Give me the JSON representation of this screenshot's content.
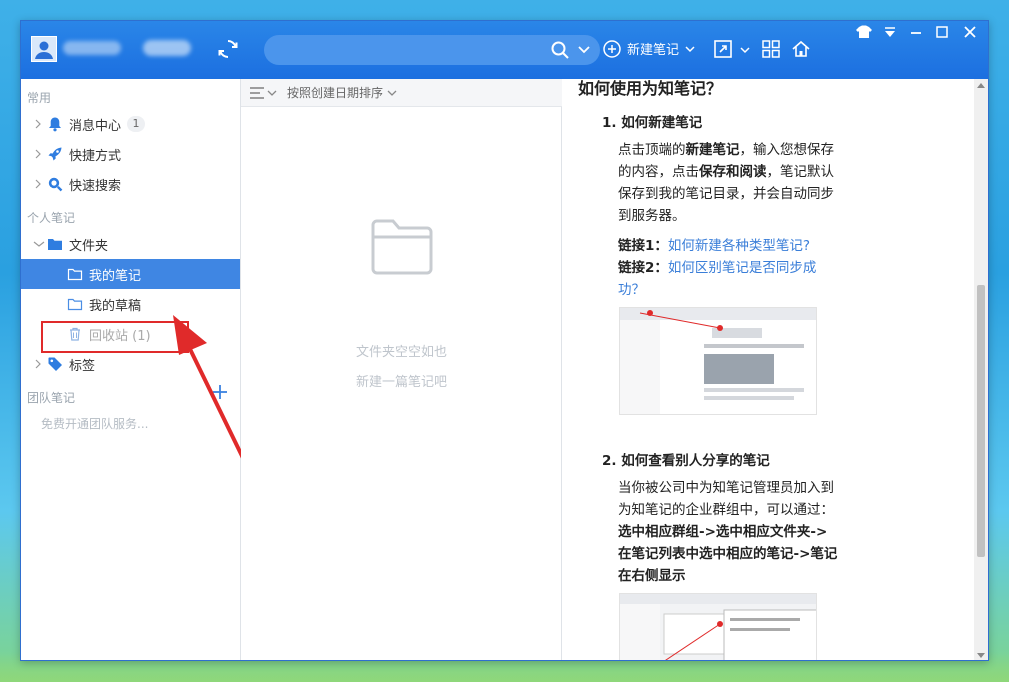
{
  "window": {
    "user_name": "",
    "search": {
      "placeholder": ""
    },
    "toolbar": {
      "new_note_label": "新建笔记"
    }
  },
  "sidebar": {
    "common_title": "常用",
    "common_items": [
      {
        "label": "消息中心",
        "badge": "1"
      },
      {
        "label": "快捷方式"
      },
      {
        "label": "快速搜索"
      }
    ],
    "personal_title": "个人笔记",
    "folder_label": "文件夹",
    "folder_children": [
      {
        "label": "我的笔记"
      },
      {
        "label": "我的草稿"
      },
      {
        "label": "回收站 (1)"
      }
    ],
    "tags_label": "标签",
    "team_title": "团队笔记",
    "team_tip": "免费开通团队服务..."
  },
  "list": {
    "sort_label": "按照创建日期排序",
    "empty_line1": "文件夹空空如也",
    "empty_line2": "新建一篇笔记吧"
  },
  "content": {
    "heading": "如何使用为知笔记？",
    "step1_title": "1. 如何新建笔记",
    "step1_para_a": "点击顶端的",
    "step1_para_b": "新建笔记",
    "step1_para_c": "，输入您想保存的内容，点击",
    "step1_para_d": "保存和阅读",
    "step1_para_e": "，笔记默认保存到我的笔记目录，并会自动同步到服务器。",
    "link1_label": "链接1：",
    "link1_text": "如何新建各种类型笔记?",
    "link2_label": "链接2：",
    "link2_text": "如何区别笔记是否同步成功？",
    "step2_title": "2. 如何查看别人分享的笔记",
    "step2_para_a": "当你被公司中为知笔记管理员加入到为知笔记的企业群组中，可以通过：",
    "step2_para_b": "选中相应群组->选中相应文件夹->在笔记列表中选中相应的笔记->笔记在右侧显示"
  },
  "colors": {
    "titlebar": "#1c6fe0",
    "selected_item": "#3f86e3",
    "annotation_red": "#e02a2a",
    "link": "#3a7ed8"
  }
}
